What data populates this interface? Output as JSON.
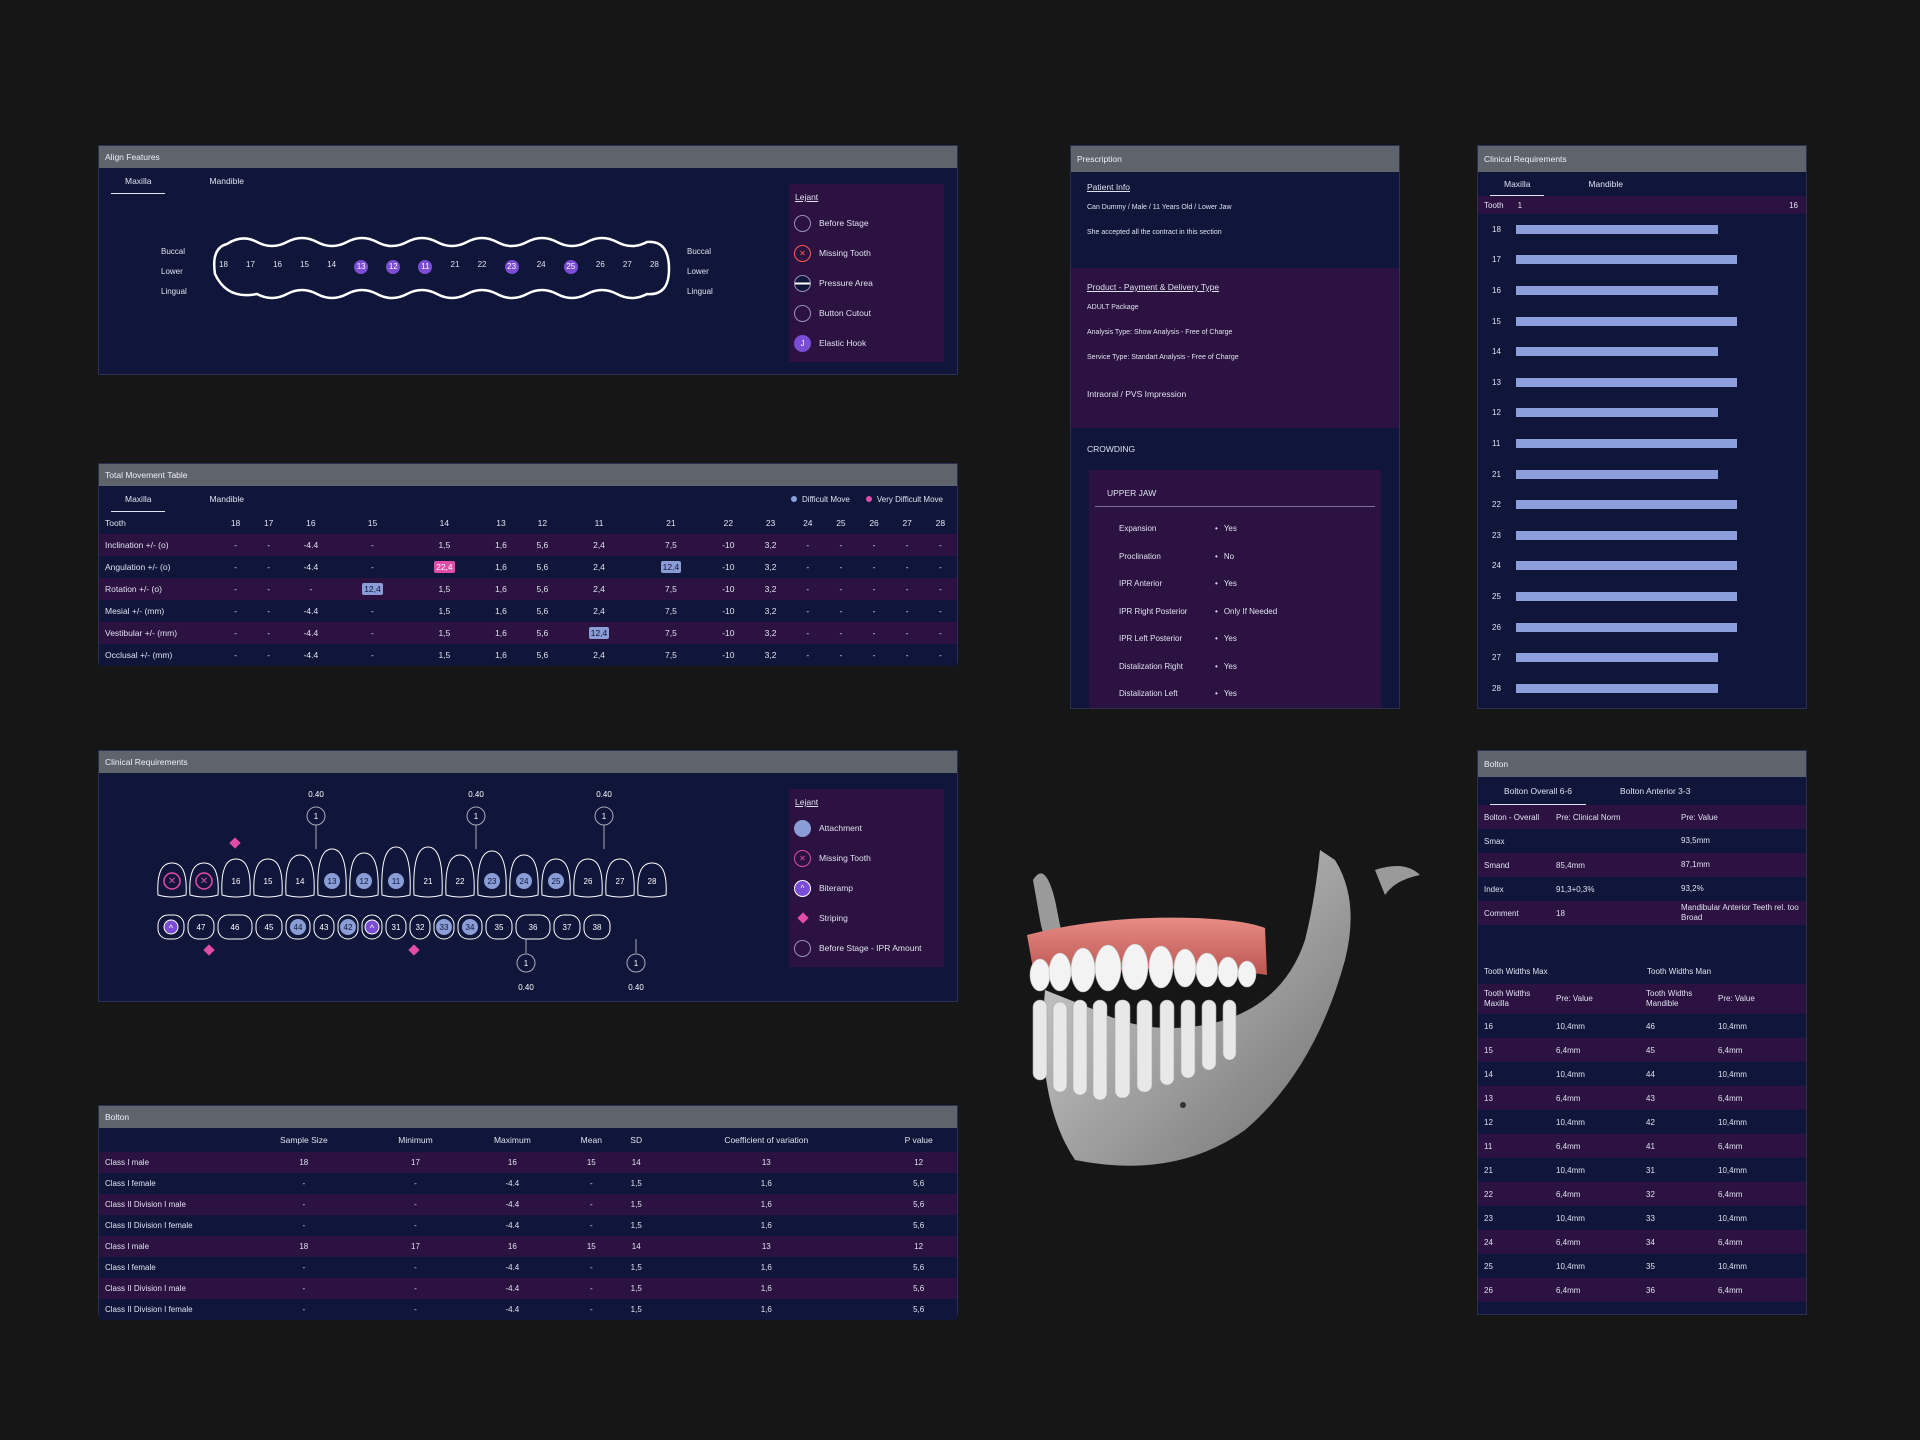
{
  "align_features": {
    "title": "Align Features",
    "tabs": [
      "Maxilla",
      "Mandible"
    ],
    "side_labels": {
      "buccal": "Buccal",
      "lower": "Lower",
      "lingual": "Lingual"
    },
    "teeth": [
      "18",
      "17",
      "16",
      "15",
      "14",
      "13",
      "12",
      "11",
      "21",
      "22",
      "23",
      "24",
      "25",
      "26",
      "27",
      "28"
    ],
    "highlighted": [
      "13",
      "12",
      "11",
      "23",
      "25"
    ],
    "legend_title": "Lejant",
    "legend": [
      "Before Stage",
      "Missing Tooth",
      "Pressure Area",
      "Button Cutout",
      "Elastic Hook"
    ],
    "elastic_hook_glyph": "J"
  },
  "movement": {
    "title": "Total Movement Table",
    "tabs": [
      "Maxilla",
      "Mandible"
    ],
    "legend": {
      "difficult": "Difficult Move",
      "very_difficult": "Very Difficult Move"
    },
    "header_label": "Tooth",
    "teeth": [
      "18",
      "17",
      "16",
      "15",
      "14",
      "13",
      "12",
      "11",
      "21",
      "22",
      "23",
      "24",
      "25",
      "26",
      "27",
      "28"
    ],
    "rows": [
      {
        "label": "Inclination +/- (o)",
        "cells": [
          "-",
          "-",
          "-4.4",
          "-",
          "1,5",
          "1,6",
          "5,6",
          "2,4",
          "7,5",
          "-10",
          "3,2",
          "-",
          "-",
          "-",
          "-",
          "-"
        ]
      },
      {
        "label": "Angulation +/- (o)",
        "cells": [
          "-",
          "-",
          "-4.4",
          "-",
          "22,4",
          "1,6",
          "5,6",
          "2,4",
          "12,4",
          "-10",
          "3,2",
          "-",
          "-",
          "-",
          "-",
          "-"
        ],
        "pink": [
          4
        ],
        "blue": [
          8
        ]
      },
      {
        "label": "Rotation +/- (o)",
        "cells": [
          "-",
          "-",
          "-",
          "12,4",
          "1,5",
          "1,6",
          "5,6",
          "2,4",
          "7,5",
          "-10",
          "3,2",
          "-",
          "-",
          "-",
          "-",
          "-"
        ],
        "blue": [
          3
        ]
      },
      {
        "label": "Mesial +/- (mm)",
        "cells": [
          "-",
          "-",
          "-4.4",
          "-",
          "1,5",
          "1,6",
          "5,6",
          "2,4",
          "7,5",
          "-10",
          "3,2",
          "-",
          "-",
          "-",
          "-",
          "-"
        ]
      },
      {
        "label": "Vestibular +/- (mm)",
        "cells": [
          "-",
          "-",
          "-4.4",
          "-",
          "1,5",
          "1,6",
          "5,6",
          "12,4",
          "7,5",
          "-10",
          "3,2",
          "-",
          "-",
          "-",
          "-",
          "-"
        ],
        "blue": [
          7
        ]
      },
      {
        "label": "Occlusal +/- (mm)",
        "cells": [
          "-",
          "-",
          "-4.4",
          "-",
          "1,5",
          "1,6",
          "5,6",
          "2,4",
          "7,5",
          "-10",
          "3,2",
          "-",
          "-",
          "-",
          "-",
          "-"
        ]
      }
    ]
  },
  "clinical_left": {
    "title": "Clinical Requirements",
    "upper_teeth": [
      "18",
      "17",
      "16",
      "15",
      "14",
      "13",
      "12",
      "11",
      "21",
      "22",
      "23",
      "24",
      "25",
      "26",
      "27",
      "28"
    ],
    "upper_attach": [
      "13",
      "12",
      "11",
      "23",
      "24",
      "25"
    ],
    "upper_missing": [
      "18",
      "17"
    ],
    "lower_teeth": [
      "48",
      "47",
      "46",
      "45",
      "44",
      "43",
      "42",
      "41",
      "31",
      "32",
      "33",
      "34",
      "35",
      "36",
      "37",
      "38"
    ],
    "lower_attach": [
      "44",
      "42",
      "33",
      "34"
    ],
    "lower_biteramp": [
      "48",
      "41"
    ],
    "ipr_top": [
      {
        "tooth": "14",
        "value": "0.40",
        "count": "1"
      },
      {
        "tooth": "22",
        "value": "0.40",
        "count": "1"
      },
      {
        "tooth": "26",
        "value": "0.40",
        "count": "1"
      }
    ],
    "ipr_bottom": [
      {
        "tooth": "32",
        "value": "0.40",
        "count": "1"
      },
      {
        "tooth": "36",
        "value": "0.40",
        "count": "1"
      }
    ],
    "legend_title": "Lejant",
    "legend": [
      "Attachment",
      "Missing Tooth",
      "Biteramp",
      "Striping",
      "Before Stage - IPR Amount"
    ]
  },
  "bolton_left": {
    "title": "Bolton",
    "headers": [
      "",
      "Sample Size",
      "Minimum",
      "Maximum",
      "Mean",
      "SD",
      "Coefficient of variation",
      "P value"
    ],
    "rows": [
      [
        "Class I male",
        "18",
        "17",
        "16",
        "15",
        "14",
        "13",
        "12"
      ],
      [
        "Class I female",
        "-",
        "-",
        "-4.4",
        "-",
        "1,5",
        "1,6",
        "5,6"
      ],
      [
        "Class II Division I male",
        "-",
        "-",
        "-4.4",
        "-",
        "1,5",
        "1,6",
        "5,6"
      ],
      [
        "Class II Division I female",
        "-",
        "-",
        "-4.4",
        "-",
        "1,5",
        "1,6",
        "5,6"
      ],
      [
        "Class I male",
        "18",
        "17",
        "16",
        "15",
        "14",
        "13",
        "12"
      ],
      [
        "Class I female",
        "-",
        "-",
        "-4.4",
        "-",
        "1,5",
        "1,6",
        "5,6"
      ],
      [
        "Class II Division I male",
        "-",
        "-",
        "-4.4",
        "-",
        "1,5",
        "1,6",
        "5,6"
      ],
      [
        "Class II Division I female",
        "-",
        "-",
        "-4.4",
        "-",
        "1,5",
        "1,6",
        "5,6"
      ]
    ]
  },
  "prescription": {
    "title": "Prescription",
    "patient_title": "Patient Info",
    "patient_lines": [
      "Can Dummy / Male / 11 Years Old / Lower Jaw",
      "She accepted all the contract in this section"
    ],
    "product_title": "Product - Payment & Delivery Type",
    "product_lines": [
      "ADULT Package",
      "Analysis Type: Show Analysis - Free of Charge",
      "Service Type: Standart Analysis - Free of Charge"
    ],
    "impression": "Intraoral / PVS Impression",
    "crowding": "CROWDING",
    "upper_jaw": "UPPER JAW",
    "items": [
      {
        "k": "Expansion",
        "v": "Yes"
      },
      {
        "k": "Proclination",
        "v": "No"
      },
      {
        "k": "IPR Anterior",
        "v": "Yes"
      },
      {
        "k": "IPR Right Posterior",
        "v": "Only If Needed"
      },
      {
        "k": "IPR Left Posterior",
        "v": "Yes"
      },
      {
        "k": "Distalization Right",
        "v": "Yes"
      },
      {
        "k": "Distalization Left",
        "v": "Yes"
      }
    ]
  },
  "clinical_right": {
    "title": "Clinical Requirements",
    "tabs": [
      "Maxilla",
      "Mandible"
    ],
    "header": {
      "label": "Tooth",
      "min": "1",
      "max": "16"
    },
    "rows": [
      {
        "tooth": "18",
        "value": 12
      },
      {
        "tooth": "17",
        "value": 13
      },
      {
        "tooth": "16",
        "value": 12
      },
      {
        "tooth": "15",
        "value": 13
      },
      {
        "tooth": "14",
        "value": 12
      },
      {
        "tooth": "13",
        "value": 13
      },
      {
        "tooth": "12",
        "value": 12
      },
      {
        "tooth": "11",
        "value": 13
      },
      {
        "tooth": "21",
        "value": 12
      },
      {
        "tooth": "22",
        "value": 13
      },
      {
        "tooth": "23",
        "value": 13
      },
      {
        "tooth": "24",
        "value": 13
      },
      {
        "tooth": "25",
        "value": 13
      },
      {
        "tooth": "26",
        "value": 13
      },
      {
        "tooth": "27",
        "value": 12
      },
      {
        "tooth": "28",
        "value": 12
      }
    ]
  },
  "bolton_right": {
    "title": "Bolton",
    "tabs": [
      "Bolton Overall 6-6",
      "Bolton Anterior 3-3"
    ],
    "overall_headers": [
      "Bolton - Overall",
      "Pre: Clinical Norm",
      "Pre: Value"
    ],
    "overall_rows": [
      [
        "Smax",
        "",
        "93,5mm"
      ],
      [
        "Smand",
        "85,4mm",
        "87,1mm"
      ],
      [
        "Index",
        "91,3+0,3%",
        "93,2%"
      ],
      [
        "Comment",
        "18",
        "Mandibular Anterior Teeth rel. too Broad"
      ]
    ],
    "widths_titles": [
      "Tooth Widths Max",
      "Tooth Widths Man"
    ],
    "widths_headers": [
      "Tooth Widths Maxilla",
      "Pre: Value",
      "Tooth Widths Mandible",
      "Pre: Value"
    ],
    "widths_rows": [
      [
        "16",
        "10,4mm",
        "46",
        "10,4mm"
      ],
      [
        "15",
        "6,4mm",
        "45",
        "6,4mm"
      ],
      [
        "14",
        "10,4mm",
        "44",
        "10,4mm"
      ],
      [
        "13",
        "6,4mm",
        "43",
        "6,4mm"
      ],
      [
        "12",
        "10,4mm",
        "42",
        "10,4mm"
      ],
      [
        "11",
        "6,4mm",
        "41",
        "6,4mm"
      ],
      [
        "21",
        "10,4mm",
        "31",
        "10,4mm"
      ],
      [
        "22",
        "6,4mm",
        "32",
        "6,4mm"
      ],
      [
        "23",
        "10,4mm",
        "33",
        "10,4mm"
      ],
      [
        "24",
        "6,4mm",
        "34",
        "6,4mm"
      ],
      [
        "25",
        "10,4mm",
        "35",
        "10,4mm"
      ],
      [
        "26",
        "6,4mm",
        "36",
        "6,4mm"
      ]
    ]
  },
  "colors": {
    "panel": "#10163a",
    "alt_row": "#2b1240",
    "accent_purple": "#7b4dd6",
    "pink": "#e04ca8",
    "bar": "#8c9fdc"
  }
}
